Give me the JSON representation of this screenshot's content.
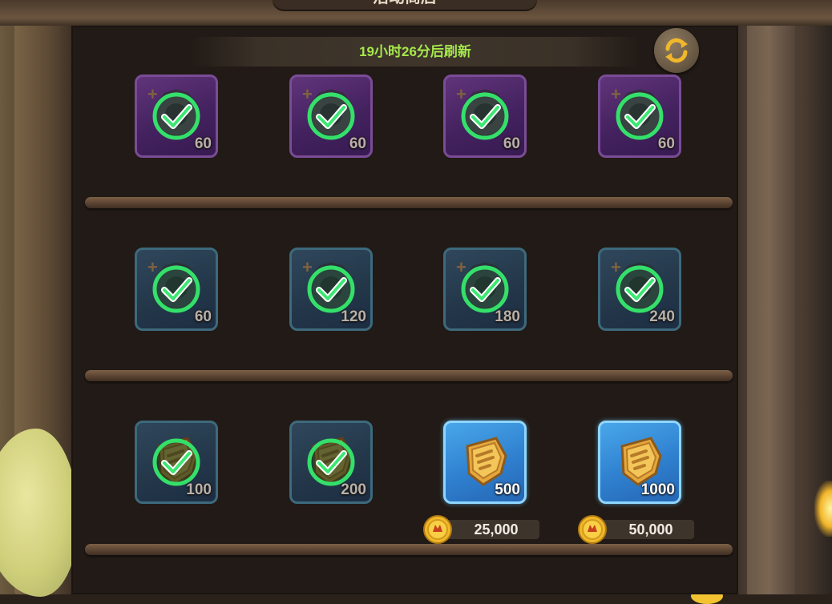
{
  "header": {
    "title": "活动商店"
  },
  "refresh": {
    "countdown_text": "19小时26分后刷新",
    "refresh_icon": "refresh-icon"
  },
  "colors": {
    "accent_green": "#a5e84c",
    "purple_frame": "#5e2e86",
    "teal_frame": "#2d5066",
    "blue_frame": "#2f80cf",
    "coin_gold": "#f2c230"
  },
  "shelves": [
    {
      "row": 1,
      "items": [
        {
          "quantity": "60",
          "rarity": "purple",
          "icon": "gear-token-icon",
          "purchased": true
        },
        {
          "quantity": "60",
          "rarity": "purple",
          "icon": "gear-token-icon",
          "purchased": true
        },
        {
          "quantity": "60",
          "rarity": "purple",
          "icon": "gear-token-icon",
          "purchased": true
        },
        {
          "quantity": "60",
          "rarity": "purple",
          "icon": "gear-token-icon",
          "purchased": true
        }
      ]
    },
    {
      "row": 2,
      "items": [
        {
          "quantity": "60",
          "rarity": "teal",
          "icon": "gear-token-icon",
          "purchased": true
        },
        {
          "quantity": "120",
          "rarity": "teal",
          "icon": "gear-token-icon",
          "purchased": true
        },
        {
          "quantity": "180",
          "rarity": "teal",
          "icon": "gear-token-icon",
          "purchased": true
        },
        {
          "quantity": "240",
          "rarity": "teal",
          "icon": "gear-token-icon",
          "purchased": true
        }
      ]
    },
    {
      "row": 3,
      "items": [
        {
          "quantity": "100",
          "rarity": "teal",
          "icon": "gold-badge-icon",
          "purchased": true
        },
        {
          "quantity": "200",
          "rarity": "teal",
          "icon": "gold-badge-icon",
          "purchased": true
        },
        {
          "quantity": "500",
          "rarity": "blue",
          "icon": "gold-badge-icon",
          "purchased": false,
          "price": "25,000",
          "currency_icon": "coin-icon"
        },
        {
          "quantity": "1000",
          "rarity": "blue",
          "icon": "gold-badge-icon",
          "purchased": false,
          "price": "50,000",
          "currency_icon": "coin-icon"
        }
      ]
    }
  ]
}
